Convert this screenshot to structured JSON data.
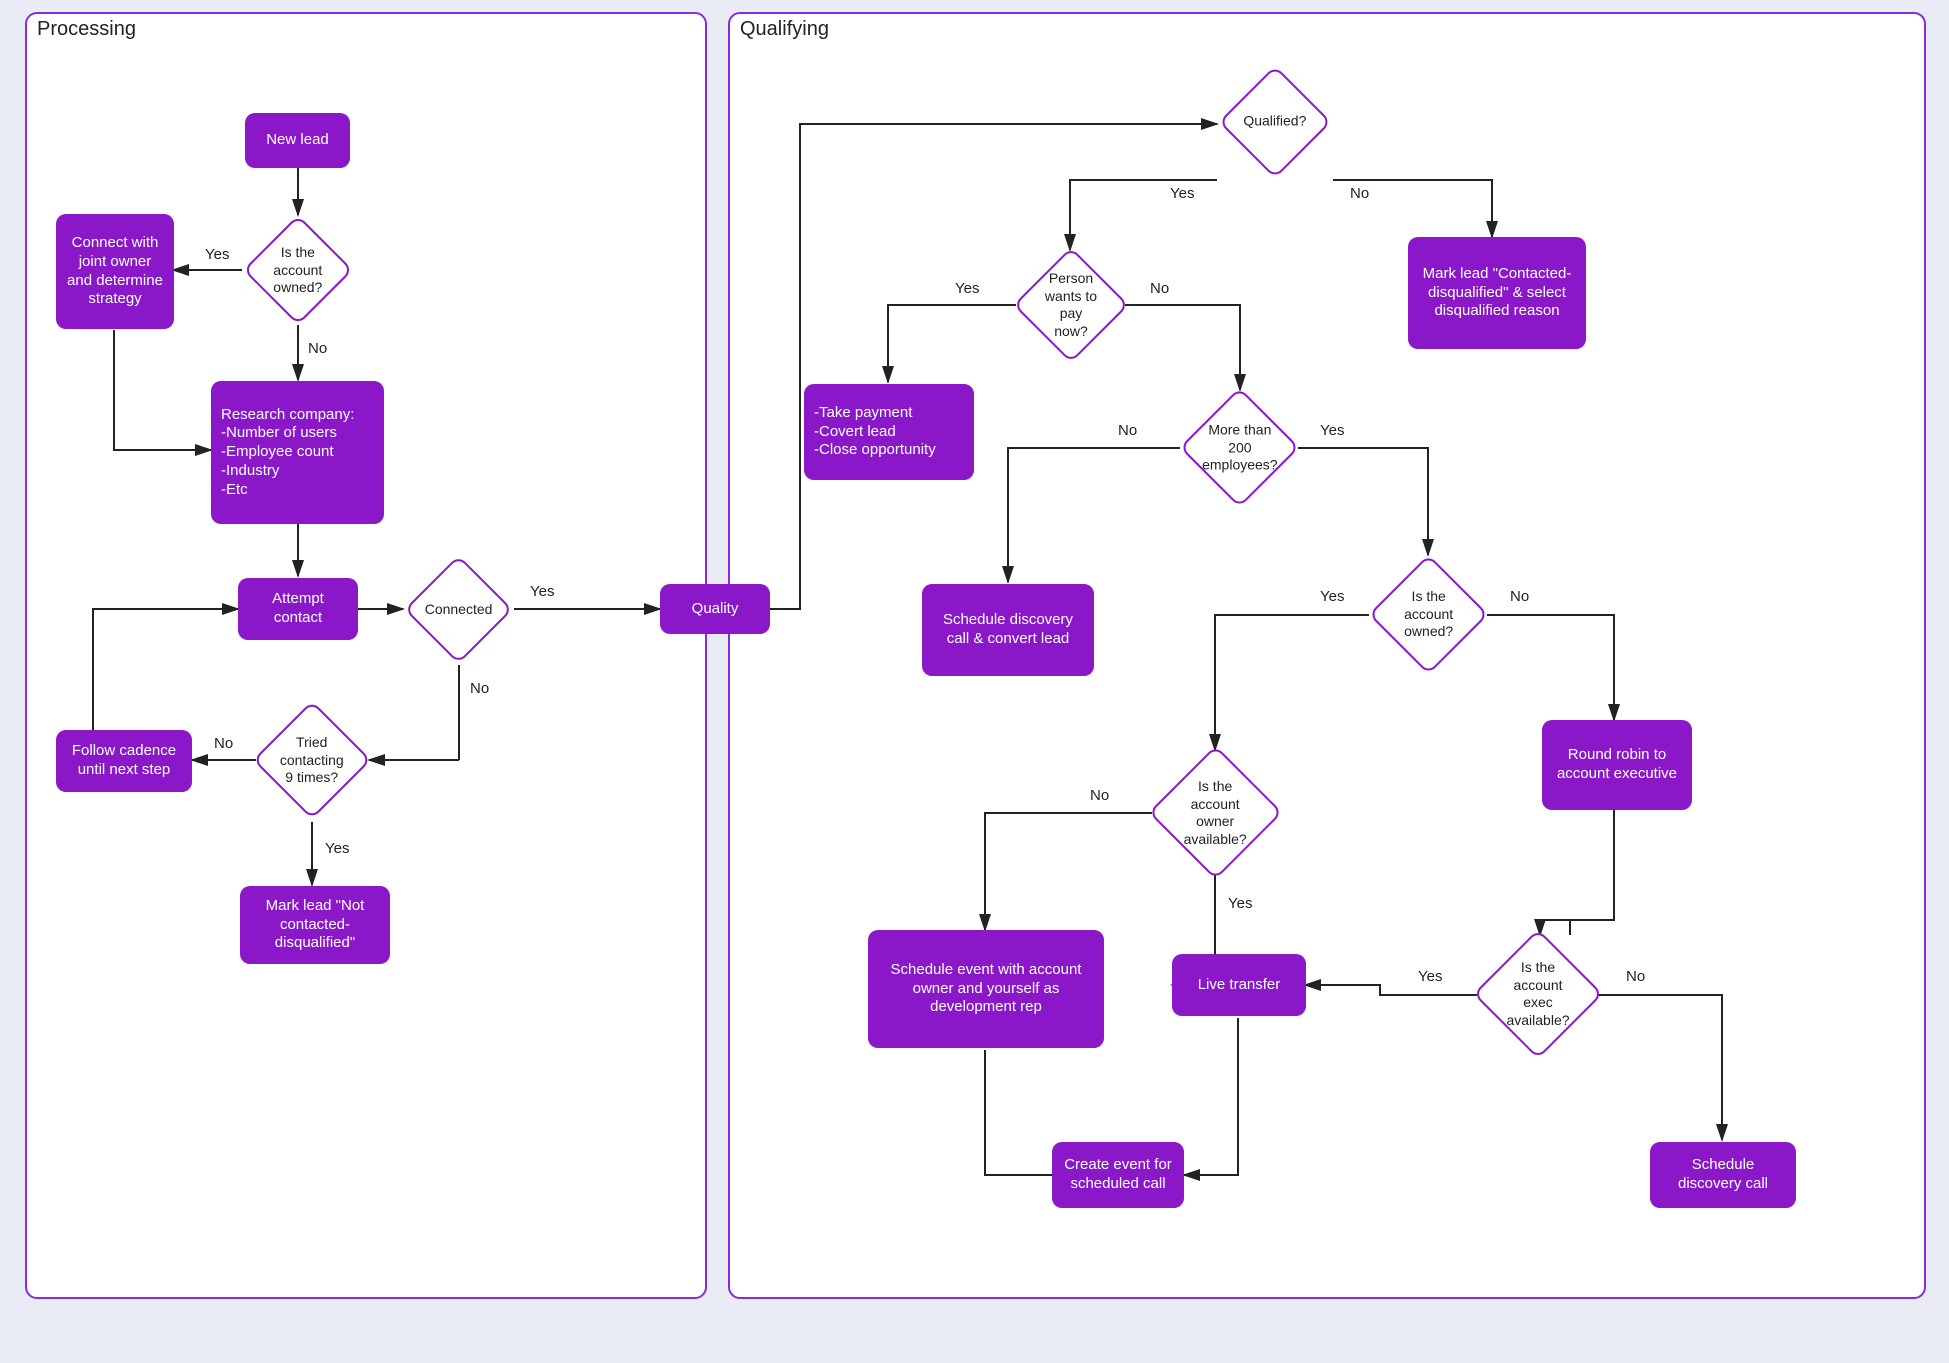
{
  "panels": {
    "processing": "Processing",
    "qualifying": "Qualifying"
  },
  "labels": {
    "yes": "Yes",
    "no": "No"
  },
  "nodes": {
    "new_lead": "New lead",
    "is_account_owned": "Is the account owned?",
    "connect_joint": "Connect with joint owner and determine strategy",
    "research": "Research company:\n-Number of users\n-Employee count\n-Industry\n-Etc",
    "attempt_contact": "Attempt contact",
    "connected": "Connected",
    "tried9": "Tried contacting 9 times?",
    "follow_cadence": "Follow cadence until next step",
    "mark_not_contacted": "Mark lead \"Not contacted-disqualified\"",
    "quality": "Quality",
    "qualified": "Qualified?",
    "mark_disq": "Mark lead \"Contacted-disqualified\" & select disqualified reason",
    "pay_now": "Person wants to pay now?",
    "take_payment": "-Take payment\n-Covert lead\n-Close opportunity",
    "more200": "More than 200 employees?",
    "sched_discovery_convert": "Schedule discovery call & convert lead",
    "acct_owned2": "Is the account owned?",
    "round_robin": "Round robin to account executive",
    "owner_available": "Is the account owner available?",
    "sched_event_owner": "Schedule event with account owner and yourself as development rep",
    "live_transfer": "Live transfer",
    "exec_available": "Is the account exec available?",
    "create_event": "Create event for scheduled call",
    "sched_discovery": "Schedule discovery call"
  }
}
